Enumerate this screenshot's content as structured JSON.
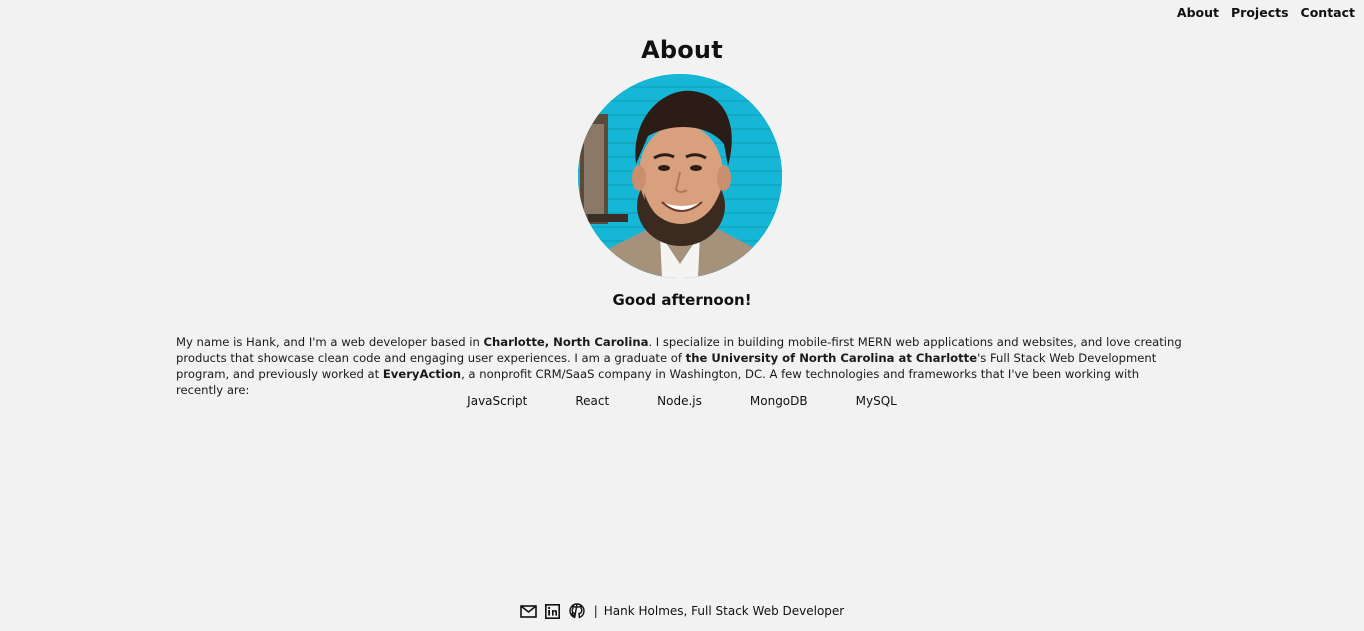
{
  "nav": {
    "items": [
      {
        "label": "About"
      },
      {
        "label": "Projects"
      },
      {
        "label": "Contact"
      }
    ]
  },
  "main": {
    "title": "About",
    "greeting": "Good afternoon!",
    "bio": {
      "p1": "My name is Hank, and I'm a web developer based in ",
      "loc": "Charlotte, North Carolina",
      "p2": ". I specialize in building mobile-first MERN web applications and websites, and love creating products that showcase clean code and engaging user experiences. I am a graduate of ",
      "school": "the University of North Carolina at Charlotte",
      "p3": "'s Full Stack Web Development program, and previously worked at ",
      "company": "EveryAction",
      "p4": ", a nonprofit CRM/SaaS company in Washington, DC. A few technologies and frameworks that I've been working with recently are:"
    },
    "technologies": [
      "JavaScript",
      "React",
      "Node.js",
      "MongoDB",
      "MySQL"
    ]
  },
  "footer": {
    "icons": [
      "mail-icon",
      "linkedin-icon",
      "github-icon"
    ],
    "separator": "|",
    "credit": "Hank Holmes, Full Stack Web Developer"
  },
  "colors": {
    "background": "#f2f2f2",
    "text": "#111111",
    "avatar_bg": "#16b7d6"
  }
}
